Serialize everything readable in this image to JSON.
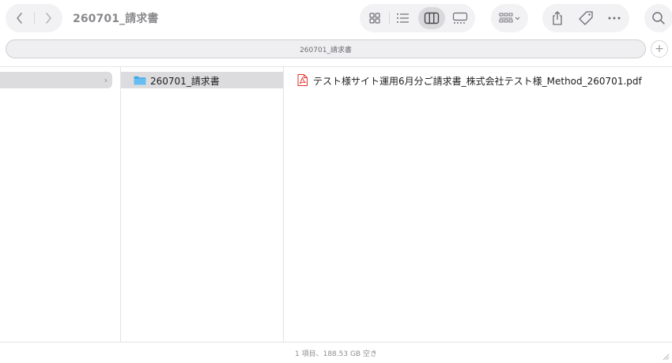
{
  "window": {
    "title": "260701_請求書"
  },
  "toolbar": {
    "back_icon": "chevron-left-icon",
    "forward_icon": "chevron-right-icon",
    "views": [
      "icon-view",
      "list-view",
      "column-view",
      "gallery-view"
    ],
    "selected_view": "column-view",
    "group_icon": "group-by-icon",
    "share_icon": "share-icon",
    "tag_icon": "tag-icon",
    "more_icon": "more-icon",
    "search_icon": "search-icon"
  },
  "tabbar": {
    "tab_title": "260701_請求書",
    "add_tab": "+"
  },
  "columns": {
    "col1": {
      "selected_chevron": "›"
    },
    "col2": {
      "folder_name": "260701_請求書"
    },
    "col3": {
      "file_name": "テスト様サイト運用6月分ご請求書_株式会社テスト様_Method_260701.pdf"
    }
  },
  "status": {
    "text": "1 項目、188.53 GB 空き"
  },
  "colors": {
    "selection_grey": "#dcdcde",
    "folder_blue": "#3fa6e8",
    "pdf_red": "#e0322b",
    "toolbar_pill": "#f2f2f4"
  }
}
